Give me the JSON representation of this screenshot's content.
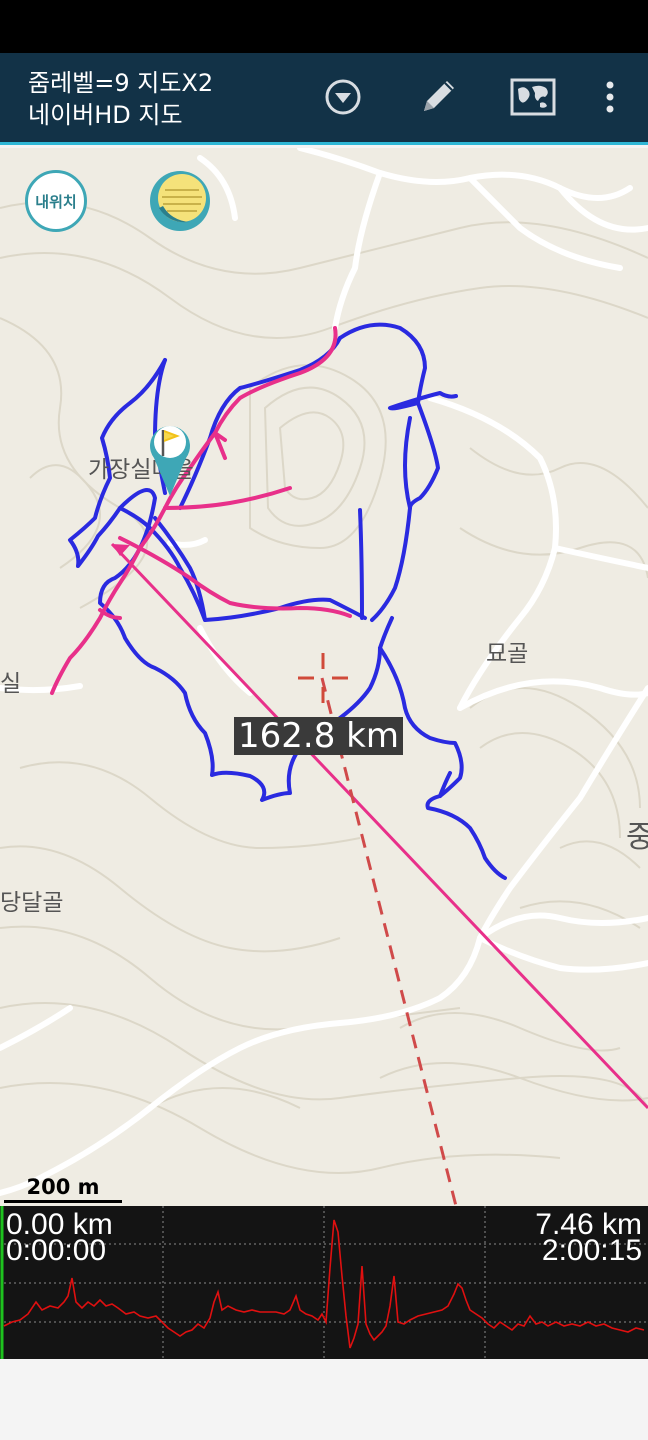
{
  "toolbar": {
    "zoom_label": "줌레벨=9 지도X2",
    "map_name": "네이버HD 지도",
    "dropdown_icon": "chevron-circle-down-icon",
    "edit_icon": "pencil-icon",
    "map_icon": "map-icon",
    "menu_icon": "overflow-menu-icon"
  },
  "map": {
    "my_location_label": "내위치",
    "labels": {
      "village_1": "가장실마을",
      "village_2": "묘골",
      "village_3": "실",
      "village_4": "당달골",
      "village_5": "중"
    },
    "distance_label": "162.8 km",
    "scale_label": "200 m",
    "colors": {
      "track_recorded": "#2a2ae0",
      "track_planned": "#e8308a",
      "bearing_line": "#e8308a",
      "target_line": "#d04a4a",
      "crosshair": "#d04a3a"
    }
  },
  "profile": {
    "start_distance": "0.00 km",
    "start_time": "0:00:00",
    "end_distance": "7.46 km",
    "end_time": "2:00:15",
    "line_color": "#e01010"
  }
}
